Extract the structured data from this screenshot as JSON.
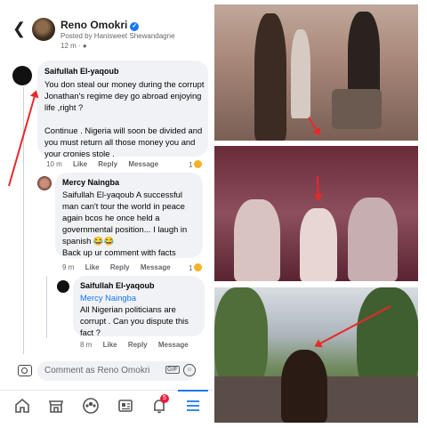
{
  "post": {
    "author": "Reno Omokri",
    "posted_by": "Posted by Hanisweet Shewandagne",
    "time": "12 m ·"
  },
  "comments": [
    {
      "name": "Saifullah El-yaqoub",
      "text": "You don steal our money during the corrupt Jonathan's regime dey go abroad enjoying life ,right ?\n\nContinue . Nigeria will soon be divided and you must return all those money you  and your cronies stole .",
      "time": "10 m",
      "actions": [
        "Like",
        "Reply",
        "Message"
      ],
      "reactions": "1"
    },
    {
      "name": "Mercy Naingba",
      "text": "Saifullah El-yaqoub A successful man can't tour the world in peace again bcos he once held a governmental position... I laugh in spanish 😂😂\nBack up ur comment with facts",
      "time": "9 m",
      "actions": [
        "Like",
        "Reply",
        "Message"
      ],
      "reactions": "1"
    },
    {
      "name": "Saifullah El-yaqoub",
      "mention": "Mercy Naingba",
      "text": "All Nigerian politicians are corrupt . Can you dispute this fact ?",
      "time": "8 m",
      "actions": [
        "Like",
        "Reply",
        "Message"
      ]
    }
  ],
  "composer": {
    "placeholder": "Comment as Reno Omokri",
    "gif": "GIF"
  },
  "nav": {
    "icons": [
      "home-icon",
      "marketplace-icon",
      "groups-icon",
      "news-icon",
      "notifications-icon",
      "menu-icon"
    ],
    "badge": "5"
  },
  "colors": {
    "accent": "#1877f2",
    "arrow": "#e8282b",
    "bubble": "#f0f2f5"
  }
}
